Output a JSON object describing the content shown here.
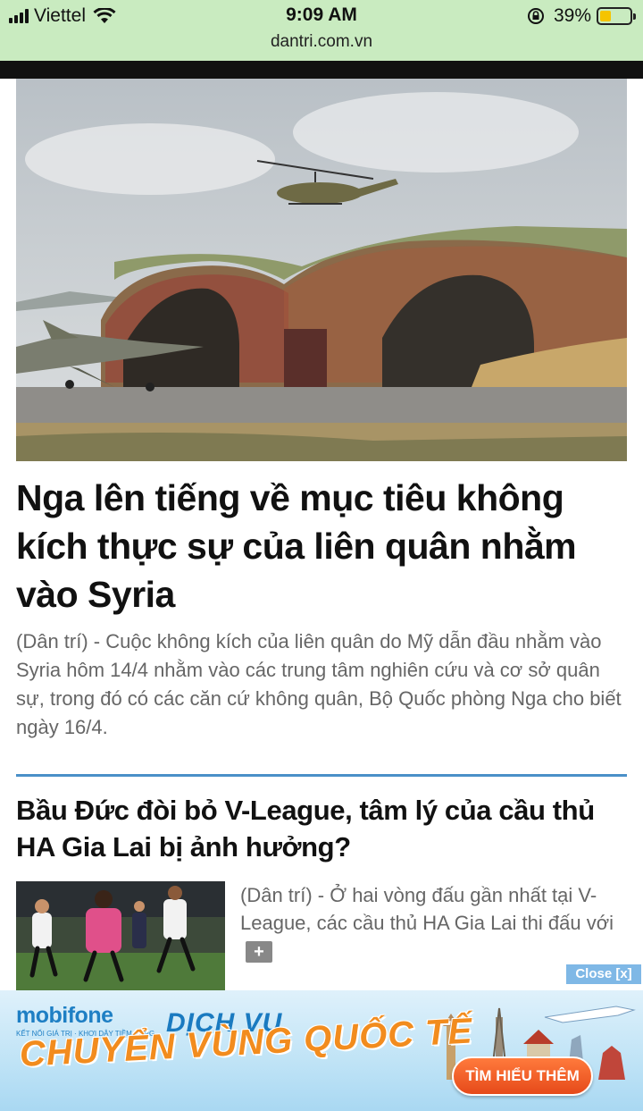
{
  "status_bar": {
    "carrier": "Viettel",
    "time": "9:09 AM",
    "battery_percent": "39%",
    "battery_level": 0.39,
    "url": "dantri.com.vn"
  },
  "article_main": {
    "headline": "Nga lên tiếng về mục tiêu không kích thực sự của liên quân nhằm vào Syria",
    "summary": "(Dân trí) - Cuộc không kích của liên quân do Mỹ dẫn đầu nhằm vào Syria hôm 14/4 nhằm vào các trung tâm nghiên cứu và cơ sở quân sự, trong đó có các căn cứ không quân, Bộ Quốc phòng Nga cho biết ngày 16/4."
  },
  "article_second": {
    "headline": "Bầu Đức đòi bỏ V-League, tâm lý của cầu thủ HA Gia Lai bị ảnh hưởng?",
    "summary": "(Dân trí) - Ở hai vòng đấu gần nhất tại V-League, các cầu thủ HA Gia Lai thi đấu với",
    "more_label": "+"
  },
  "ad": {
    "close_label": "Close [x]",
    "brand": "mobifone",
    "brand_tagline": "KẾT NỐI GIÁ TRỊ · KHƠI DẬY TIỀM NĂNG",
    "title_top": "DỊCH VỤ",
    "title_main": "CHUYỂN VÙNG QUỐC TẾ",
    "cta_label": "TÌM HIỂU THÊM"
  },
  "colors": {
    "status_bg": "#c9ebc0",
    "divider": "#4a90c8",
    "ad_orange": "#f28c1e",
    "ad_blue": "#1a7ac0"
  }
}
